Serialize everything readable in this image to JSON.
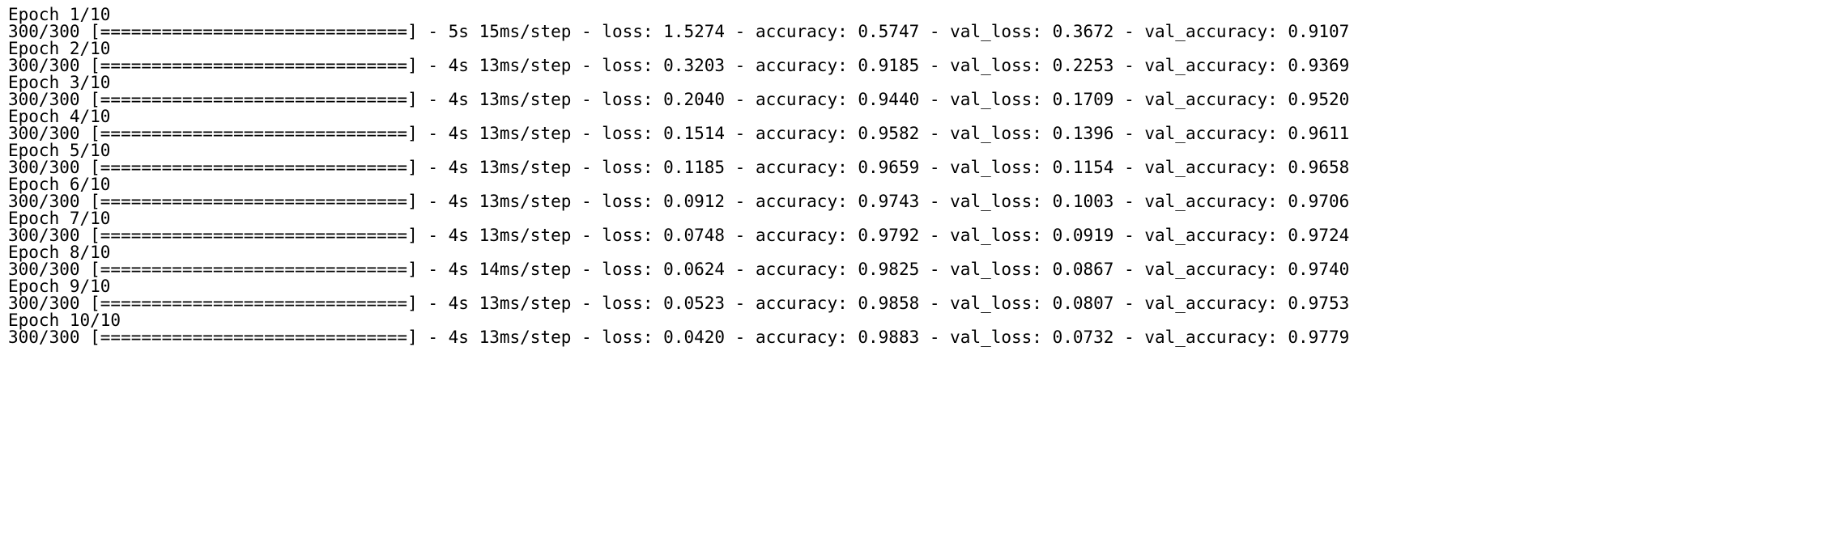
{
  "training": {
    "total_epochs": 10,
    "steps": 300,
    "bar": "[==============================]",
    "epochs": [
      {
        "n": 1,
        "time": "5s",
        "per_step": "15ms/step",
        "loss": "1.5274",
        "accuracy": "0.5747",
        "val_loss": "0.3672",
        "val_accuracy": "0.9107"
      },
      {
        "n": 2,
        "time": "4s",
        "per_step": "13ms/step",
        "loss": "0.3203",
        "accuracy": "0.9185",
        "val_loss": "0.2253",
        "val_accuracy": "0.9369"
      },
      {
        "n": 3,
        "time": "4s",
        "per_step": "13ms/step",
        "loss": "0.2040",
        "accuracy": "0.9440",
        "val_loss": "0.1709",
        "val_accuracy": "0.9520"
      },
      {
        "n": 4,
        "time": "4s",
        "per_step": "13ms/step",
        "loss": "0.1514",
        "accuracy": "0.9582",
        "val_loss": "0.1396",
        "val_accuracy": "0.9611"
      },
      {
        "n": 5,
        "time": "4s",
        "per_step": "13ms/step",
        "loss": "0.1185",
        "accuracy": "0.9659",
        "val_loss": "0.1154",
        "val_accuracy": "0.9658"
      },
      {
        "n": 6,
        "time": "4s",
        "per_step": "13ms/step",
        "loss": "0.0912",
        "accuracy": "0.9743",
        "val_loss": "0.1003",
        "val_accuracy": "0.9706"
      },
      {
        "n": 7,
        "time": "4s",
        "per_step": "13ms/step",
        "loss": "0.0748",
        "accuracy": "0.9792",
        "val_loss": "0.0919",
        "val_accuracy": "0.9724"
      },
      {
        "n": 8,
        "time": "4s",
        "per_step": "14ms/step",
        "loss": "0.0624",
        "accuracy": "0.9825",
        "val_loss": "0.0867",
        "val_accuracy": "0.9740"
      },
      {
        "n": 9,
        "time": "4s",
        "per_step": "13ms/step",
        "loss": "0.0523",
        "accuracy": "0.9858",
        "val_loss": "0.0807",
        "val_accuracy": "0.9753"
      },
      {
        "n": 10,
        "time": "4s",
        "per_step": "13ms/step",
        "loss": "0.0420",
        "accuracy": "0.9883",
        "val_loss": "0.0732",
        "val_accuracy": "0.9779"
      }
    ]
  }
}
